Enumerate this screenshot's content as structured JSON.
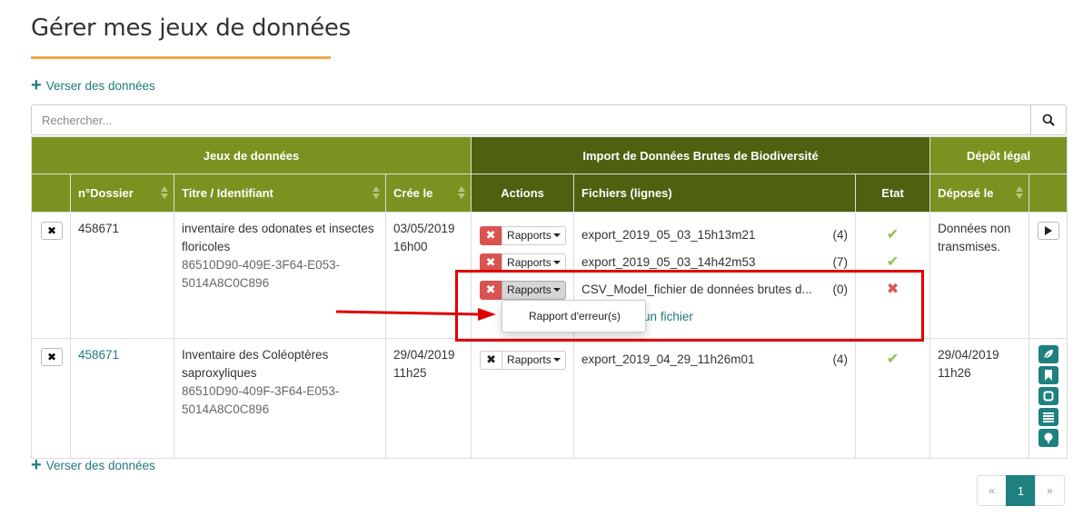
{
  "page": {
    "title": "Gérer mes jeux de données"
  },
  "actions": {
    "add_data_top": "Verser des données",
    "add_data_bottom": "Verser des données"
  },
  "search": {
    "placeholder": "Rechercher..."
  },
  "table": {
    "group_headers": {
      "datasets": "Jeux de données",
      "import": "Import de Données Brutes de Biodiversité",
      "legal": "Dépôt légal"
    },
    "columns": {
      "dossier": "n°Dossier",
      "title": "Titre / Identifiant",
      "created": "Crée le",
      "actions": "Actions",
      "files": "Fichiers (lignes)",
      "state": "Etat",
      "deposited": "Déposé le"
    },
    "rows": [
      {
        "dossier": "458671",
        "title": "inventaire des odonates et insectes floricoles",
        "identifier": "86510D90-409E-3F64-E053-5014A8C0C896",
        "created_date": "03/05/2019",
        "created_time": "16h00",
        "files": [
          {
            "report_label": "Rapports",
            "name": "export_2019_05_03_15h13m21",
            "count": "(4)",
            "state": "ok"
          },
          {
            "report_label": "Rapports",
            "name": "export_2019_05_03_14h42m53",
            "count": "(7)",
            "state": "ok"
          },
          {
            "report_label": "Rapports",
            "name": "CSV_Model_fichier de données brutes d...",
            "count": "(0)",
            "state": "error"
          }
        ],
        "add_file_label": "un fichier",
        "deposit_status": "Données non transmises."
      },
      {
        "dossier": "458671",
        "title": "Inventaire des Coléoptères saproxyliques",
        "identifier": "86510D90-409F-3F64-E053-5014A8C0C896",
        "created_date": "29/04/2019",
        "created_time": "11h25",
        "files": [
          {
            "report_label": "Rapports",
            "name": "export_2019_04_29_11h26m01",
            "count": "(4)",
            "state": "ok"
          }
        ],
        "deposit_date": "29/04/2019",
        "deposit_time": "11h26"
      }
    ]
  },
  "dropdown": {
    "item": "Rapport d'erreur(s)"
  },
  "pagination": {
    "prev": "«",
    "current": "1",
    "next": "»"
  },
  "icons": {
    "search": "search-icon",
    "remove": "close-icon",
    "ok": "check-icon",
    "error": "close-icon",
    "play": "play-icon",
    "leaf": "leaf-icon",
    "bookmark": "bookmark-icon",
    "square": "square-icon",
    "list": "list-icon",
    "tree": "tree-icon",
    "plus": "plus-icon"
  },
  "colors": {
    "header_green": "#7a9320",
    "header_dark": "#4f6110",
    "accent_teal": "#1f8080",
    "underline_orange": "#f0a54a",
    "error_red": "#d9534f",
    "ok_green": "#8dc04b",
    "annotation_red": "#e00000"
  }
}
